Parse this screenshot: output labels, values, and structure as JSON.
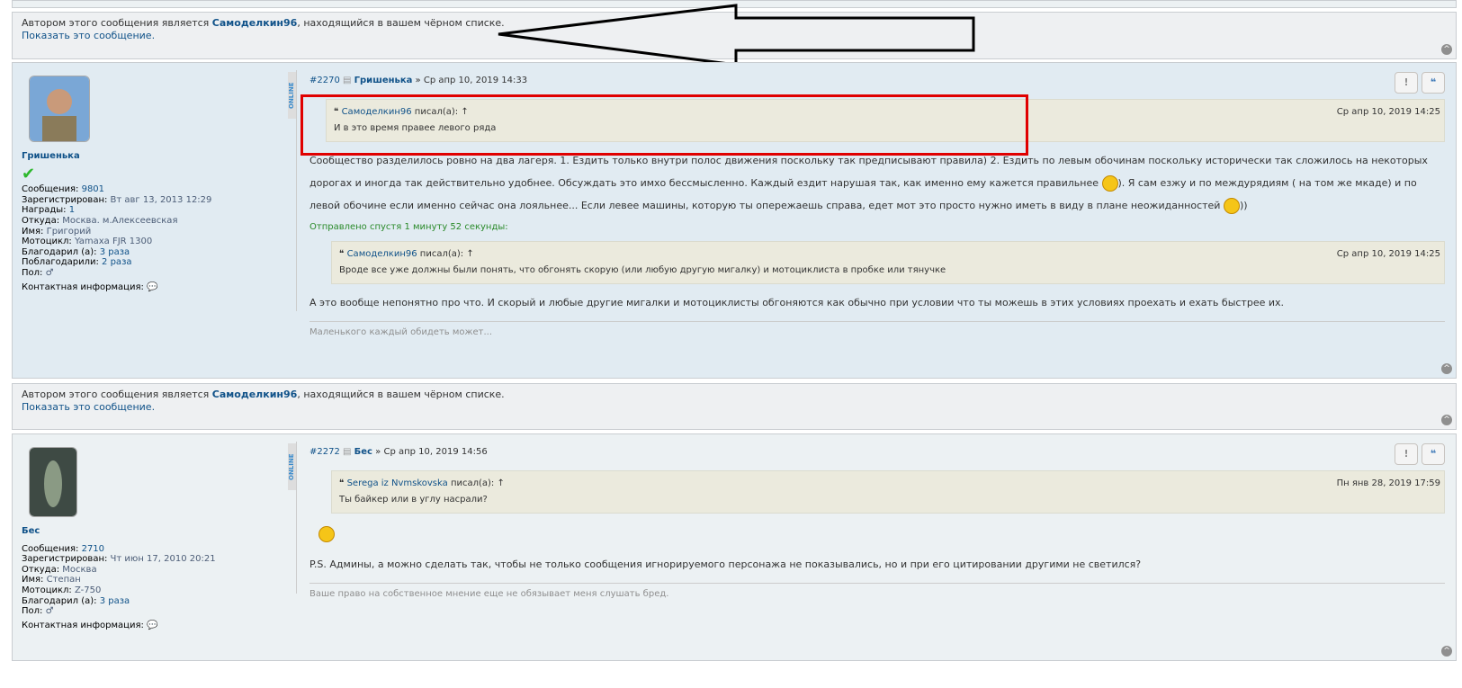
{
  "ignored_1": {
    "prefix": "Автором этого сообщения является ",
    "author": "Самоделкин96",
    "suffix": ", находящийся в вашем чёрном списке.",
    "show": "Показать это сообщение."
  },
  "post1": {
    "number": "#2270",
    "author": "Гришенька",
    "date": "Ср апр 10, 2019 14:33",
    "online": "ONLINE",
    "profile": {
      "name": "Гришенька",
      "rows": [
        {
          "label": "Сообщения:",
          "value": "9801",
          "link": true
        },
        {
          "label": "Зарегистрирован:",
          "value": "Вт авг 13, 2013 12:29"
        },
        {
          "label": "Награды:",
          "value": "1",
          "link": true
        },
        {
          "label": "Откуда:",
          "value": "Москва. м.Алексеевская"
        },
        {
          "label": "Имя:",
          "value": "Григорий"
        },
        {
          "label": "Мотоцикл:",
          "value": "Yamaxa FJR 1300"
        },
        {
          "label": "Благодарил (а):",
          "value": "3 раза",
          "link": true
        },
        {
          "label": "Поблагодарили:",
          "value": "2 раза",
          "link": true
        },
        {
          "label": "Пол:",
          "value": "♂"
        }
      ],
      "contact": "Контактная информация:"
    },
    "quote1": {
      "author": "Самоделкин96",
      "wrote": " писал(а): ↑",
      "date": "Ср апр 10, 2019 14:25",
      "text": "И в это время правее левого ряда"
    },
    "text1a": "Сообщество разделилось ровно на два лагеря. 1. Ездить только внутри полос движения поскольку так предписывают правила) 2. Ездить по левым обочинам поскольку исторически так сложилось на некоторых дорогах и иногда так действительно удобнее. Обсуждать это имхо бессмысленно. Каждый ездит нарушая так, как именно ему кажется правильнее ",
    "text1b": "). Я сам езжу и по междурядиям ( на том же мкаде) и по левой обочине если именно сейчас она лояльнее... Если левее машины, которую ты опережаешь справа, едет мот это просто нужно иметь в виду в плане неожиданностей ",
    "text1c": "))",
    "sent": "Отправлено спустя 1 минуту 52 секунды:",
    "quote2": {
      "author": "Самоделкин96",
      "wrote": " писал(а): ↑",
      "date": "Ср апр 10, 2019 14:25",
      "text": "Вроде все уже должны были понять, что обгонять скорую (или любую другую мигалку) и мотоциклиста в пробке или тянучке"
    },
    "text2": "А это вообще непонятно про что. И скорый и любые другие мигалки и мотоциклисты обгоняются как обычно при условии что ты можешь в этих условиях проехать и ехать быстрее их.",
    "signature": "Маленького каждый обидеть может..."
  },
  "ignored_2": {
    "prefix": "Автором этого сообщения является ",
    "author": "Самоделкин96",
    "suffix": ", находящийся в вашем чёрном списке.",
    "show": "Показать это сообщение."
  },
  "post2": {
    "number": "#2272",
    "author": "Бес",
    "date": "Ср апр 10, 2019 14:56",
    "online": "ONLINE",
    "profile": {
      "name": "Бес",
      "rows": [
        {
          "label": "Сообщения:",
          "value": "2710",
          "link": true
        },
        {
          "label": "Зарегистрирован:",
          "value": "Чт июн 17, 2010 20:21"
        },
        {
          "label": "Откуда:",
          "value": "Москва"
        },
        {
          "label": "Имя:",
          "value": "Степан"
        },
        {
          "label": "Мотоцикл:",
          "value": "Z-750"
        },
        {
          "label": "Благодарил (а):",
          "value": "3 раза",
          "link": true
        },
        {
          "label": "Пол:",
          "value": "♂"
        }
      ],
      "contact": "Контактная информация:"
    },
    "quote1": {
      "author": "Serega iz Nvmskovska",
      "wrote": " писал(а): ↑",
      "date": "Пн янв 28, 2019 17:59",
      "text": "Ты байкер или в углу насрали?"
    },
    "text1": "P.S. Админы, а можно сделать так, чтобы не только сообщения игнорируемого персонажа не показывались, но и при его цитировании другими не светился?",
    "signature": "Ваше право на собственное мнение еще не обязывает меня слушать бред."
  },
  "icons": {
    "report": "!",
    "quote": "❝",
    "top": "^"
  }
}
